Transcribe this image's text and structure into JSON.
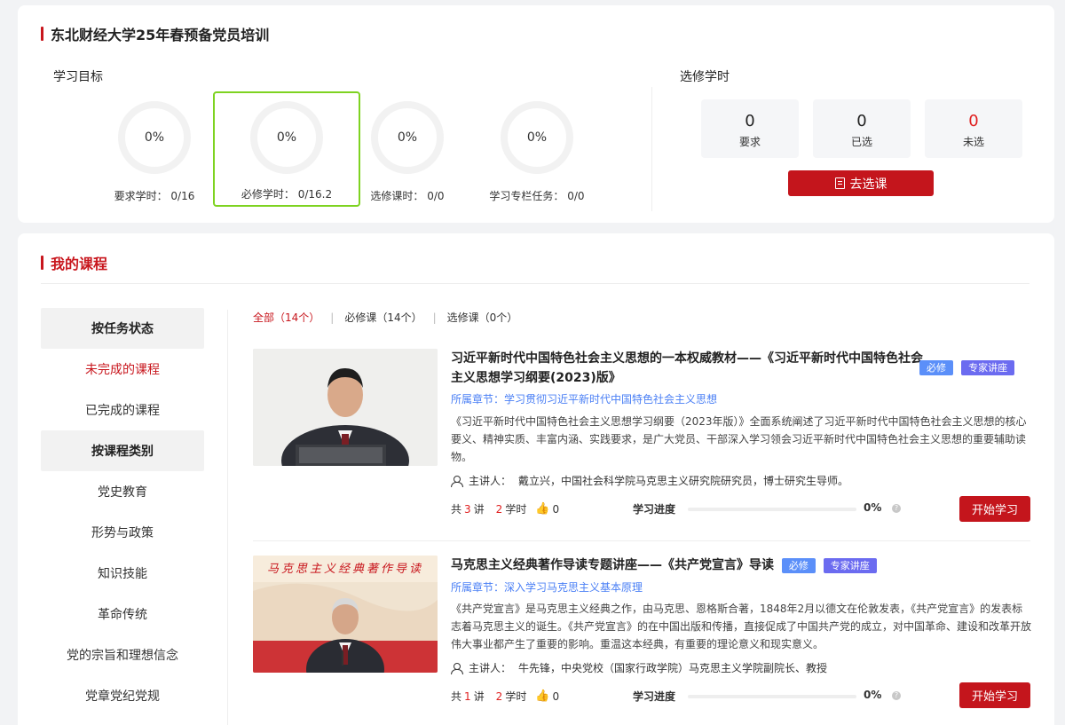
{
  "header": {
    "title": "东北财经大学25年春预备党员培训"
  },
  "goals": {
    "heading": "学习目标",
    "items": [
      {
        "pct": "0%",
        "label": "要求学时：  0/16"
      },
      {
        "pct": "0%",
        "label": "必修学时：  0/16.2"
      },
      {
        "pct": "0%",
        "label": "选修课时：  0/0"
      },
      {
        "pct": "0%",
        "label": "学习专栏任务：  0/0"
      }
    ]
  },
  "elective": {
    "heading": "选修学时",
    "stats": [
      {
        "num": "0",
        "cap": "要求"
      },
      {
        "num": "0",
        "cap": "已选"
      },
      {
        "num": "0",
        "cap": "未选"
      }
    ],
    "button": "去选课"
  },
  "courses_section": {
    "title": "我的课程",
    "side": {
      "group1": "按任务状态",
      "status_items": [
        "未完成的课程",
        "已完成的课程"
      ],
      "group2": "按课程类别",
      "category_items": [
        "党史教育",
        "形势与政策",
        "知识技能",
        "革命传统",
        "党的宗旨和理想信念",
        "党章党纪党规"
      ]
    },
    "filters": [
      "全部（14个）",
      "必修课（14个）",
      "选修课（0个）"
    ],
    "list": [
      {
        "title": "习近平新时代中国特色社会主义思想的一本权威教材——《习近平新时代中国特色社会主义思想学习纲要(2023)版》",
        "tags": [
          "必修",
          "专家讲座"
        ],
        "chapter": "所属章节：学习贯彻习近平新时代中国特色社会主义思想",
        "desc": "《习近平新时代中国特色社会主义思想学习纲要（2023年版）》全面系统阐述了习近平新时代中国特色社会主义思想的核心要义、精神实质、丰富内涵、实践要求，是广大党员、干部深入学习领会习近平新时代中国特色社会主义思想的重要辅助读物。",
        "lecturer_label": "主讲人：",
        "lecturer": "戴立兴，中国社会科学院马克思主义研究院研究员，博士研究生导师。",
        "lectures": "3",
        "hours": "2",
        "likes": "0",
        "progress_label": "学习进度",
        "progress": "0%",
        "button": "开始学习"
      },
      {
        "title": "马克思主义经典著作导读专题讲座——《共产党宣言》导读",
        "tags": [
          "必修",
          "专家讲座"
        ],
        "thumb_banner": "马克思主义经典著作导读",
        "chapter": "所属章节：深入学习马克思主义基本原理",
        "desc": "《共产党宣言》是马克思主义经典之作，由马克思、恩格斯合著，1848年2月以德文在伦敦发表，《共产党宣言》的发表标志着马克思主义的诞生。《共产党宣言》的在中国出版和传播，直接促成了中国共产党的成立，对中国革命、建设和改革开放伟大事业都产生了重要的影响。重温这本经典，有重要的理论意义和现实意义。",
        "lecturer_label": "主讲人：",
        "lecturer": "牛先锋，中央党校（国家行政学院）马克思主义学院副院长、教授",
        "lectures": "1",
        "hours": "2",
        "likes": "0",
        "progress_label": "学习进度",
        "progress": "0%",
        "button": "开始学习"
      }
    ],
    "meta_words": {
      "total": "共",
      "lecture": "讲",
      "hour": "学时"
    }
  },
  "colors": {
    "accent_red": "#c4151c",
    "link_blue": "#4a7ff5",
    "active_green": "#7ed321"
  }
}
